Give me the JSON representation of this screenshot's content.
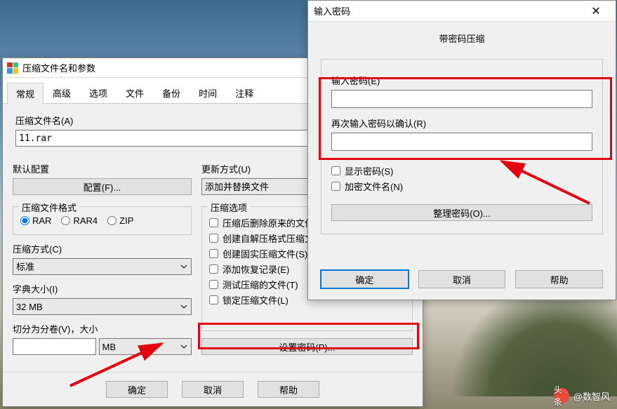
{
  "archive": {
    "title": "压缩文件名和参数",
    "tabs": [
      "常规",
      "高级",
      "选项",
      "文件",
      "备份",
      "时间",
      "注释"
    ],
    "name_label": "压缩文件名(A)",
    "name_value": "11.rar",
    "profile_label": "默认配置",
    "profile_button": "配置(F)...",
    "format_label": "压缩文件格式",
    "formats": [
      "RAR",
      "RAR4",
      "ZIP"
    ],
    "method_label": "压缩方式(C)",
    "method_value": "标准",
    "dict_label": "字典大小(I)",
    "dict_value": "32 MB",
    "split_label": "切分为分卷(V)，大小",
    "split_unit": "MB",
    "update_label": "更新方式(U)",
    "update_value": "添加并替换文件",
    "options_label": "压缩选项",
    "opts": [
      "压缩后删除原来的文件",
      "创建自解压格式压缩文件",
      "创建固实压缩文件(S)",
      "添加恢复记录(E)",
      "测试压缩的文件(T)",
      "锁定压缩文件(L)"
    ],
    "set_password": "设置密码(P)...",
    "ok": "确定",
    "cancel": "取消",
    "help": "帮助"
  },
  "pwd": {
    "title": "输入密码",
    "subtitle": "带密码压缩",
    "pw_label": "输入密码(E)",
    "pw_confirm": "再次输入密码以确认(R)",
    "show": "显示密码(S)",
    "encrypt_names": "加密文件名(N)",
    "organize": "整理密码(O)...",
    "ok": "确定",
    "cancel": "取消",
    "help": "帮助"
  },
  "watermark": {
    "prefix": "头条",
    "name": "@数智风"
  }
}
